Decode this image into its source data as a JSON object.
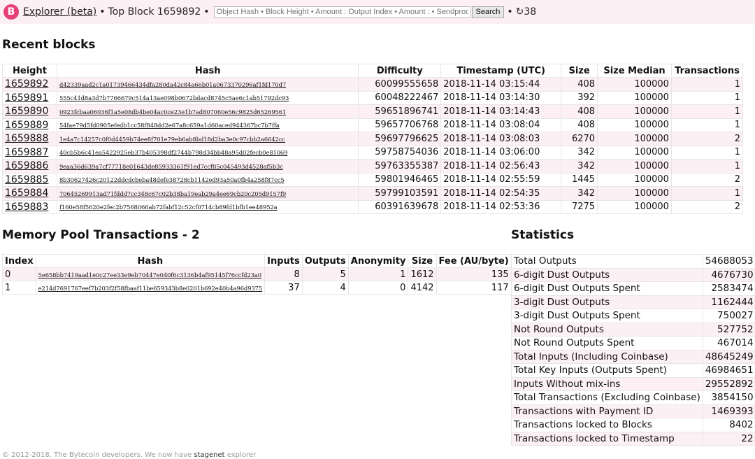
{
  "header": {
    "logo_glyph": "B",
    "explorer_label": "Explorer (beta)",
    "top_block_label": "Top Block",
    "top_block_height": "1659892",
    "separator": "•",
    "search_placeholder": "Object Hash • Block Height • Amount : Output Index • Amount : • Sendproof",
    "search_value": "",
    "search_button": "Search",
    "refresh_icon": "↻",
    "refresh_seconds": "38"
  },
  "recent_blocks": {
    "title": "Recent blocks",
    "columns": [
      "Height",
      "Hash",
      "Difficulty",
      "Timestamp (UTC)",
      "Size",
      "Size Median",
      "Transactions"
    ],
    "rows": [
      {
        "height": "1659892",
        "hash": "d42339aad2c1a01739466434dfa280da42c84a66b01a0673370296af1fd170d7",
        "difficulty": "60099555658",
        "timestamp": "2018-11-14 03:15:44",
        "size": "408",
        "size_median": "100000",
        "transactions": "1"
      },
      {
        "height": "1659891",
        "hash": "555c41d8a3d7b7766679c514a13ae098b0672bdacd8745c5ae6c1ab51792dc93",
        "difficulty": "60048222467",
        "timestamp": "2018-11-14 03:14:30",
        "size": "392",
        "size_median": "100000",
        "transactions": "1"
      },
      {
        "height": "1659890",
        "hash": "0923fcbaa06036f1a5e08db4be04ac0ce23e1b7ad807060e56c9825d65269561",
        "difficulty": "59651896741",
        "timestamp": "2018-11-14 03:14:43",
        "size": "408",
        "size_median": "100000",
        "transactions": "1"
      },
      {
        "height": "1659889",
        "hash": "54fae79d5fd0905efedb1cc58f848dd2e67a8c659a1d60aced944367bc7b7ffa",
        "difficulty": "59657706768",
        "timestamp": "2018-11-14 03:08:04",
        "size": "408",
        "size_median": "100000",
        "transactions": "1"
      },
      {
        "height": "1659888",
        "hash": "1e4a7c14257c0f0d4459b74ee8f701e79eb6ab8bd18d2ba3e0c97cbb2a6642cc",
        "difficulty": "59697796625",
        "timestamp": "2018-11-14 03:08:03",
        "size": "6270",
        "size_median": "100000",
        "transactions": "2"
      },
      {
        "height": "1659887",
        "hash": "40cb5b6c41ea5422925eb37b405398df2744b798d34bb48a95d02fecb0e81069",
        "difficulty": "59758754036",
        "timestamp": "2018-11-14 03:06:00",
        "size": "342",
        "size_median": "100000",
        "transactions": "1"
      },
      {
        "height": "1659886",
        "hash": "9eaa36d639a7cf77718e01643de85933361f91ed7ccf85c045493d4528af5b3c",
        "difficulty": "59763355387",
        "timestamp": "2018-11-14 02:56:43",
        "size": "342",
        "size_median": "100000",
        "transactions": "1"
      },
      {
        "height": "1659885",
        "hash": "8b30627426c20122ddcdcbeba48defe38728cb1142ed93a50a0fb4a258f87cc5",
        "difficulty": "59801946465",
        "timestamp": "2018-11-14 02:55:59",
        "size": "1445",
        "size_median": "100000",
        "transactions": "2"
      },
      {
        "height": "1659884",
        "hash": "70645269913ad71fddd7cc348c67c02b38ba19eab29a4ee69cb20c205d9157f9",
        "difficulty": "59799103591",
        "timestamp": "2018-11-14 02:54:35",
        "size": "342",
        "size_median": "100000",
        "transactions": "1"
      },
      {
        "height": "1659883",
        "hash": "f160e58f5620e2fec2b7568066ab72fabf12c52cf0714cb89fd1bfb1ee48952a",
        "difficulty": "60391639678",
        "timestamp": "2018-11-14 02:53:36",
        "size": "7275",
        "size_median": "100000",
        "transactions": "2"
      }
    ]
  },
  "mempool": {
    "title": "Memory Pool Transactions - 2",
    "columns": [
      "Index",
      "Hash",
      "Inputs",
      "Outputs",
      "Anonymity",
      "Size",
      "Fee (AU/byte)"
    ],
    "rows": [
      {
        "index": "0",
        "hash": "5e658bb7419aad1e0c27ee33e9eb70447e040f6c3136b4af95145f76ccfd23a0",
        "inputs": "8",
        "outputs": "5",
        "anonymity": "1",
        "size": "1612",
        "fee": "135"
      },
      {
        "index": "1",
        "hash": "e214d7691767eef7b203f2f58fbaaf11be659343b8e0201b692e40b4a96d9375",
        "inputs": "37",
        "outputs": "4",
        "anonymity": "0",
        "size": "4142",
        "fee": "117"
      }
    ]
  },
  "statistics": {
    "title": "Statistics",
    "rows": [
      {
        "label": "Total Outputs",
        "value": "54688053"
      },
      {
        "label": "6-digit Dust Outputs",
        "value": "4676730"
      },
      {
        "label": "6-digit Dust Outputs Spent",
        "value": "2583474"
      },
      {
        "label": "3-digit Dust Outputs",
        "value": "1162444"
      },
      {
        "label": "3-digit Dust Outputs Spent",
        "value": "750027"
      },
      {
        "label": "Not Round Outputs",
        "value": "527752"
      },
      {
        "label": "Not Round Outputs Spent",
        "value": "467014"
      },
      {
        "label": "Total Inputs (Including Coinbase)",
        "value": "48645249"
      },
      {
        "label": "Total Key Inputs (Outputs Spent)",
        "value": "46984651"
      },
      {
        "label": "Inputs Without mix-ins",
        "value": "29552892"
      },
      {
        "label": "Total Transactions (Excluding Coinbase)",
        "value": "3854150"
      },
      {
        "label": "Transactions with Payment ID",
        "value": "1469393"
      },
      {
        "label": "Transactions locked to Blocks",
        "value": "8402"
      },
      {
        "label": "Transactions locked to Timestamp",
        "value": "22"
      }
    ]
  },
  "footer": {
    "text": "© 2012-2018, The Bytecoin developers. We now have",
    "link": "stagenet",
    "suffix": "explorer"
  },
  "colors": {
    "brand": "#e8407a",
    "row_highlight": "#fdf0f4",
    "header_bg": "#fdf0f4"
  }
}
